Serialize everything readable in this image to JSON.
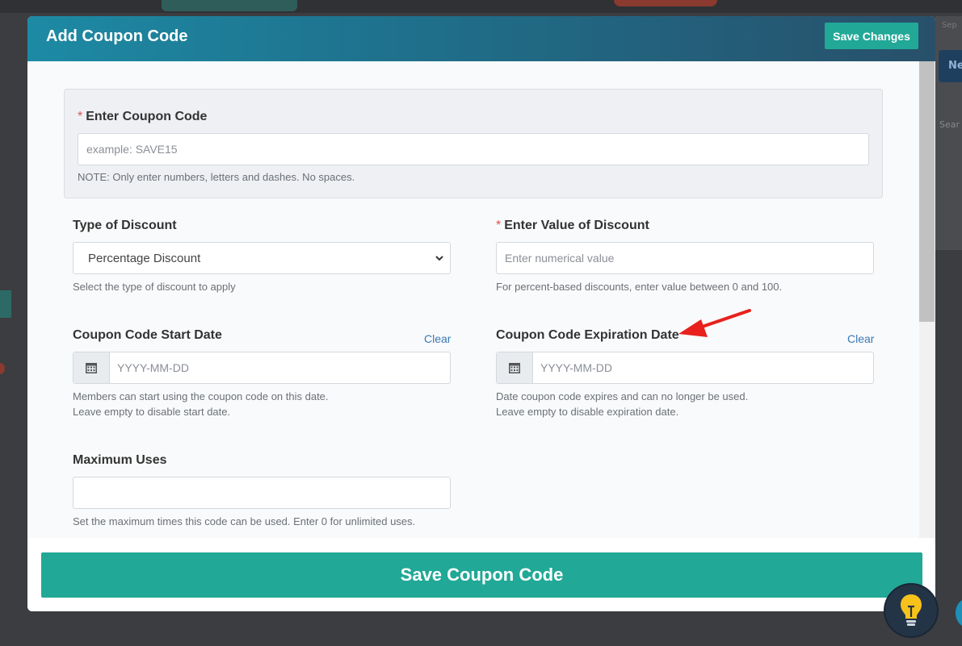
{
  "modal": {
    "title": "Add Coupon Code",
    "save_changes_label": "Save Changes",
    "save_coupon_label": "Save Coupon Code"
  },
  "coupon_code": {
    "required_mark": "*",
    "label": "Enter Coupon Code",
    "placeholder": "example: SAVE15",
    "note": "NOTE: Only enter numbers, letters and dashes. No spaces."
  },
  "discount_type": {
    "label": "Type of Discount",
    "selected": "Percentage Discount",
    "help": "Select the type of discount to apply"
  },
  "discount_value": {
    "required_mark": "*",
    "label": "Enter Value of Discount",
    "placeholder": "Enter numerical value",
    "help": "For percent-based discounts, enter value between 0 and 100."
  },
  "start_date": {
    "label": "Coupon Code Start Date",
    "clear_label": "Clear",
    "placeholder": "YYYY-MM-DD",
    "help_line1": "Members can start using the coupon code on this date.",
    "help_line2": "Leave empty to disable start date."
  },
  "expiration_date": {
    "label": "Coupon Code Expiration Date",
    "clear_label": "Clear",
    "placeholder": "YYYY-MM-DD",
    "help_line1": "Date coupon code expires and can no longer be used.",
    "help_line2": "Leave empty to disable expiration date."
  },
  "max_uses": {
    "label": "Maximum Uses",
    "value": "",
    "help": "Set the maximum times this code can be used. Enter 0 for unlimited uses."
  },
  "background": {
    "right_button_fragment": "Ne",
    "right_search_fragment": "Sear",
    "right_top_fragment": "Sep"
  },
  "colors": {
    "accent": "#21a897",
    "header_gradient_start": "#1d8aa4",
    "header_gradient_end": "#28506a",
    "required": "#d9534f",
    "link": "#3a78b7",
    "annotation_arrow": "#e8211c"
  },
  "icons": [
    "calendar-icon",
    "chevron-down-icon",
    "lightbulb-icon",
    "annotation-arrow"
  ]
}
